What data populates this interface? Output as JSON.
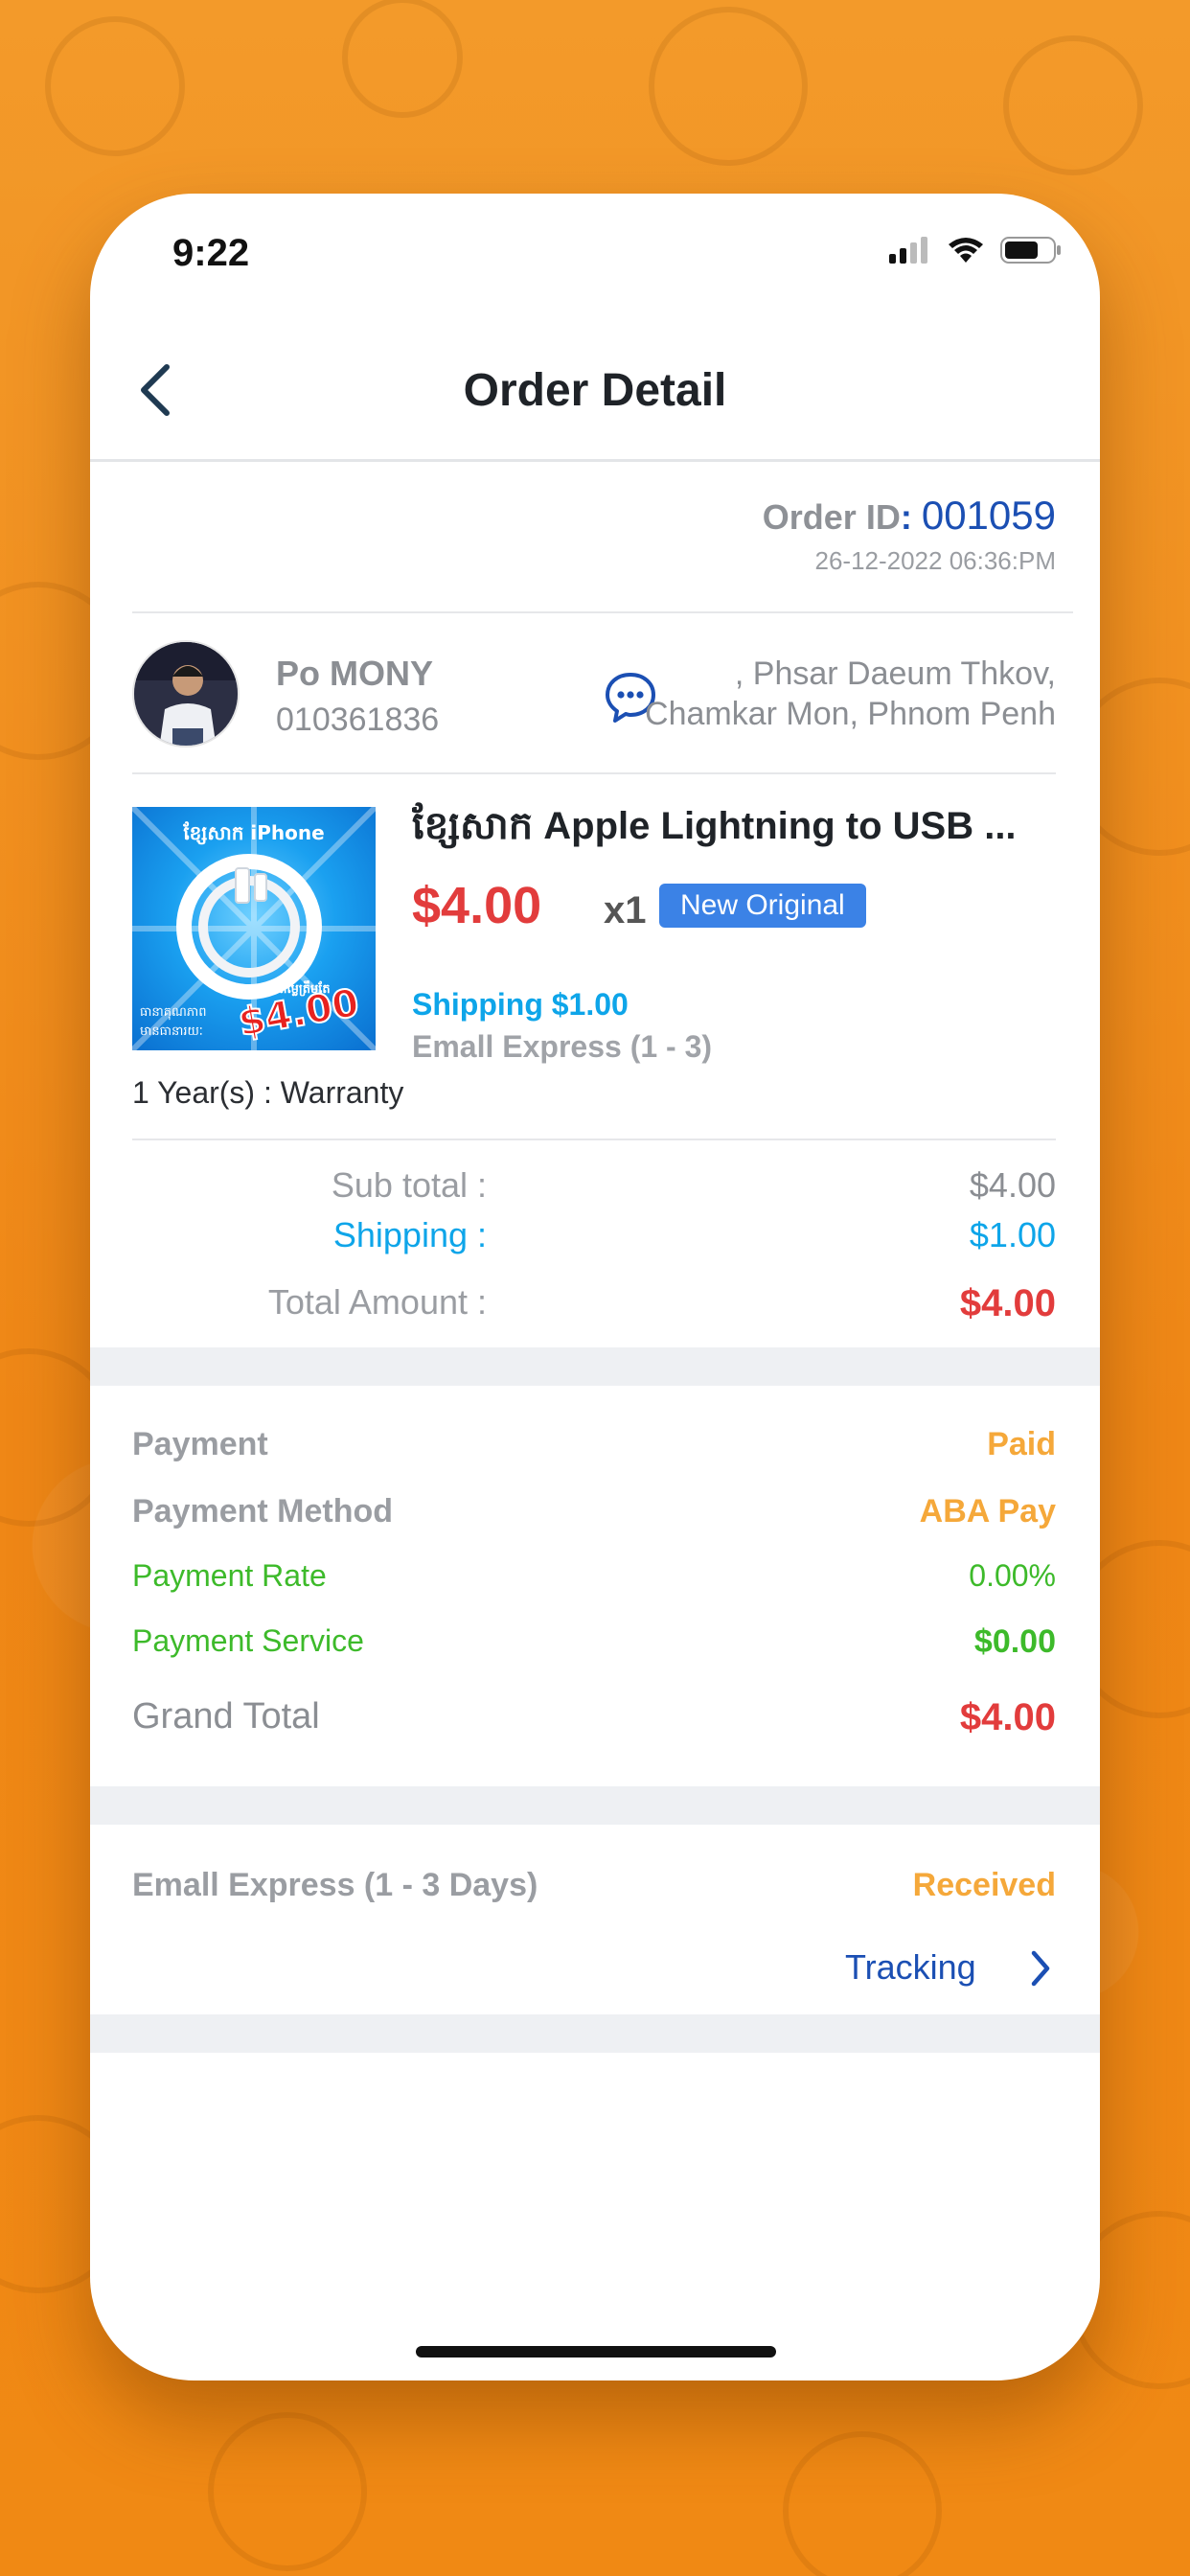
{
  "status_bar": {
    "time": "9:22"
  },
  "header": {
    "title": "Order Detail"
  },
  "order": {
    "id_label": "Order ID",
    "id_colon": ":",
    "id_value": "001059",
    "datetime": "26-12-2022 06:36:PM"
  },
  "customer": {
    "name": "Po MONY",
    "phone": "010361836",
    "address_line1": ", Phsar Daeum Thkov,",
    "address_line2": "Chamkar Mon, Phnom Penh"
  },
  "product": {
    "title": "ខ្សែសាក Apple Lightning to USB ...",
    "price": "$4.00",
    "quantity": "x1",
    "condition_badge": "New Original",
    "shipping": "Shipping $1.00",
    "shipping_method": "Emall Express (1 - 3)",
    "warranty": "1 Year(s) : Warranty",
    "image_text_top": "ខ្សែសាក iPhone",
    "image_text_price_label": "តម្លៃត្រឹមតែ",
    "image_text_price": "$4.00",
    "image_text_bottom1": "ធានាគុណភាព",
    "image_text_bottom2": "មានធានារយៈ"
  },
  "totals": {
    "subtotal_label": "Sub total :",
    "subtotal_value": "$4.00",
    "shipping_label": "Shipping :",
    "shipping_value": "$1.00",
    "total_label": "Total Amount :",
    "total_value": "$4.00"
  },
  "payment": {
    "status_label": "Payment",
    "status_value": "Paid",
    "method_label": "Payment Method",
    "method_value": "ABA Pay",
    "rate_label": "Payment Rate",
    "rate_value": "0.00%",
    "service_label": "Payment Service",
    "service_value": "$0.00",
    "grand_total_label": "Grand Total",
    "grand_total_value": "$4.00"
  },
  "delivery": {
    "method": "Emall Express (1 - 3 Days)",
    "status": "Received",
    "tracking_label": "Tracking"
  },
  "colors": {
    "brand_orange": "#f08a1c",
    "price_red": "#e23c3c",
    "link_blue": "#1b4fb3",
    "shipping_cyan": "#0ea5e9",
    "status_orange": "#f5a83a",
    "payment_green": "#3dba2a"
  }
}
